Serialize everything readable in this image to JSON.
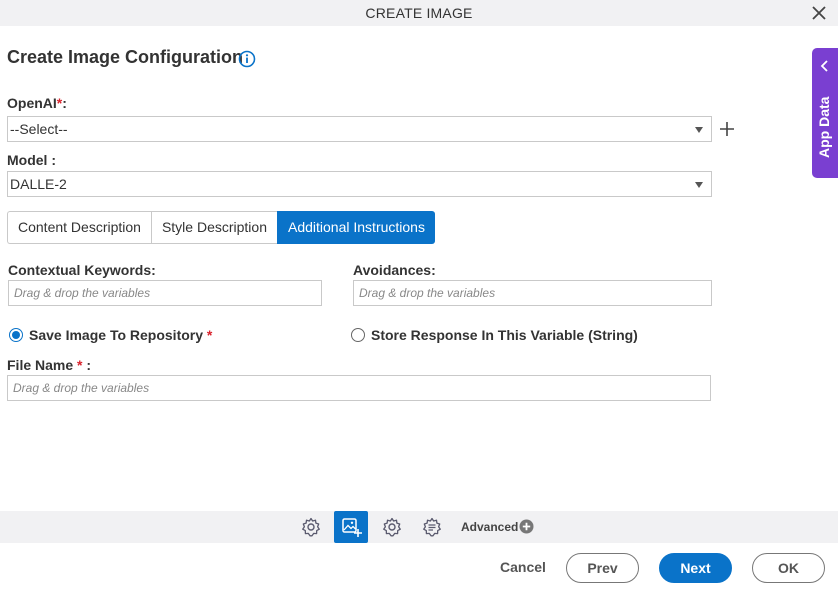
{
  "window": {
    "title": "CREATE IMAGE"
  },
  "page": {
    "heading": "Create Image Configuration"
  },
  "openai": {
    "label": "OpenAI",
    "required_mark": "*",
    "suffix": ":",
    "value": "--Select--"
  },
  "model": {
    "label": "Model :",
    "value": "DALLE-2"
  },
  "tabs": [
    {
      "label": "Content Description",
      "active": false
    },
    {
      "label": "Style Description",
      "active": false
    },
    {
      "label": "Additional Instructions",
      "active": true
    }
  ],
  "fields": {
    "contextual_keywords": {
      "label": "Contextual Keywords:",
      "placeholder": "Drag & drop the variables"
    },
    "avoidances": {
      "label": "Avoidances:",
      "placeholder": "Drag & drop the variables"
    },
    "file_name": {
      "label": "File Name",
      "required_mark": "*",
      "suffix": ":",
      "placeholder": "Drag & drop the variables"
    }
  },
  "options": {
    "save_to_repository": {
      "label": "Save Image To Repository",
      "required_mark": "*",
      "checked": true
    },
    "store_in_variable": {
      "label": "Store Response In This Variable (String)",
      "checked": false
    }
  },
  "side_panel": {
    "label": "App Data"
  },
  "toolbar": {
    "icons": [
      "gear-icon",
      "image-add-icon",
      "gear-icon",
      "gear-list-icon"
    ],
    "advanced_label": "Advanced"
  },
  "footer": {
    "cancel": "Cancel",
    "prev": "Prev",
    "next": "Next",
    "ok": "OK"
  },
  "colors": {
    "accent": "#0a73c9",
    "side_panel": "#7a3fd1",
    "required": "#d9232d"
  }
}
